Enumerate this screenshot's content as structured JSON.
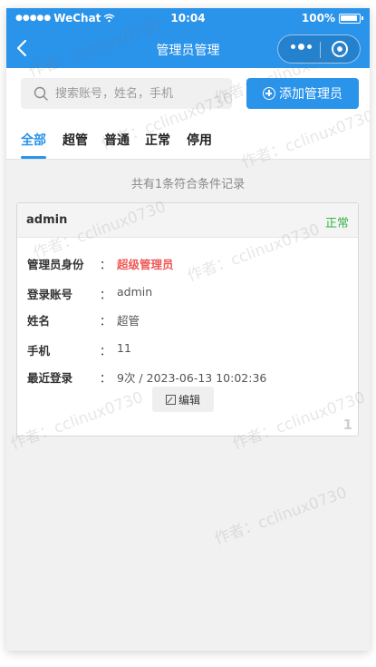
{
  "status_bar": {
    "carrier": "WeChat",
    "time": "10:04",
    "battery": "100%"
  },
  "navbar": {
    "title": "管理员管理"
  },
  "search": {
    "placeholder": "搜索账号，姓名，手机",
    "value": ""
  },
  "add_button": {
    "label": "添加管理员"
  },
  "tabs": [
    {
      "label": "全部",
      "active": true
    },
    {
      "label": "超管",
      "active": false
    },
    {
      "label": "普通",
      "active": false
    },
    {
      "label": "正常",
      "active": false
    },
    {
      "label": "停用",
      "active": false
    }
  ],
  "summary": "共有1条符合条件记录",
  "record": {
    "name": "admin",
    "status": "正常",
    "colon": "：",
    "fields": [
      {
        "label": "管理员身份",
        "value": "超级管理员"
      },
      {
        "label": "登录账号",
        "value": "admin"
      },
      {
        "label": "姓名",
        "value": "超管"
      },
      {
        "label": "手机",
        "value": "11"
      },
      {
        "label": "最近登录",
        "value": "9次 / 2023-06-13 10:02:36"
      }
    ],
    "edit_label": "编辑",
    "index": "1"
  },
  "watermark": "作者：cclinux0730",
  "colors": {
    "primary": "#2a93ea",
    "status_ok": "#38b54a",
    "role_super": "#ee5a58"
  },
  "icons": [
    "signal-icon",
    "wifi-icon",
    "battery-icon",
    "back-icon",
    "more-icon",
    "close-capsule-icon",
    "search-icon",
    "add-circle-icon",
    "edit-icon"
  ]
}
